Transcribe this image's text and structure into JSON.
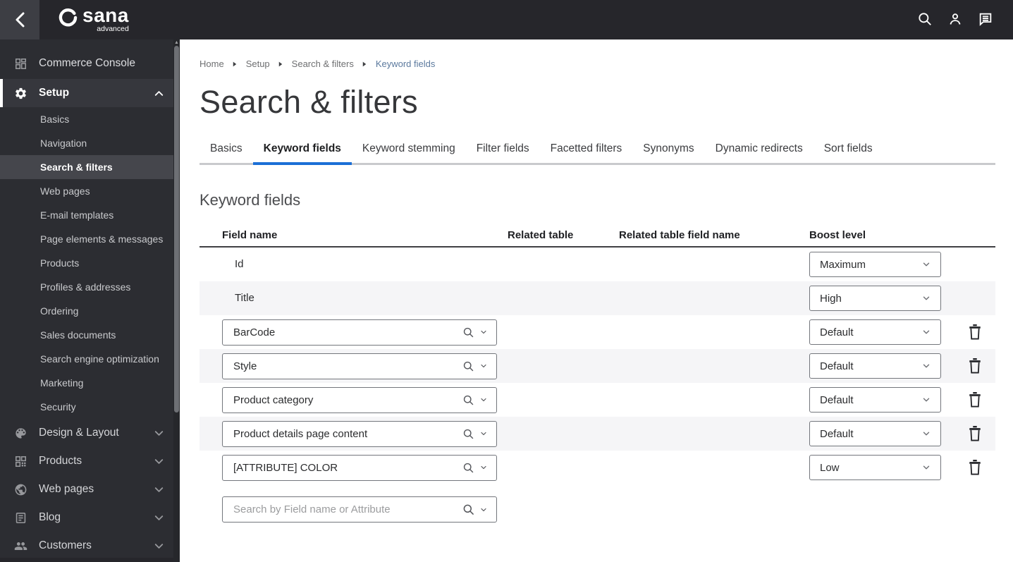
{
  "topbar": {
    "brand": "sana",
    "brand_sub": "advanced",
    "back_icon": "chevron-left-icon",
    "action_icons": [
      "search-icon",
      "account-icon",
      "feedback-icon"
    ]
  },
  "sidebar": {
    "top_item": {
      "label": "Commerce Console",
      "icon": "dashboard-icon"
    },
    "setup": {
      "label": "Setup",
      "icon": "gear-icon",
      "expanded": true
    },
    "setup_children": [
      {
        "label": "Basics",
        "active": false
      },
      {
        "label": "Navigation",
        "active": false
      },
      {
        "label": "Search & filters",
        "active": true
      },
      {
        "label": "Web pages",
        "active": false
      },
      {
        "label": "E-mail templates",
        "active": false
      },
      {
        "label": "Page elements & messages",
        "active": false
      },
      {
        "label": "Products",
        "active": false
      },
      {
        "label": "Profiles & addresses",
        "active": false
      },
      {
        "label": "Ordering",
        "active": false
      },
      {
        "label": "Sales documents",
        "active": false
      },
      {
        "label": "Search engine optimization",
        "active": false
      },
      {
        "label": "Marketing",
        "active": false
      },
      {
        "label": "Security",
        "active": false
      }
    ],
    "groups": [
      {
        "label": "Design & Layout",
        "icon": "palette-icon"
      },
      {
        "label": "Products",
        "icon": "products-grid-icon"
      },
      {
        "label": "Web pages",
        "icon": "globe-icon"
      },
      {
        "label": "Blog",
        "icon": "blog-icon"
      },
      {
        "label": "Customers",
        "icon": "customers-icon"
      }
    ]
  },
  "breadcrumb": [
    "Home",
    "Setup",
    "Search & filters",
    "Keyword fields"
  ],
  "page": {
    "title": "Search & filters",
    "section_heading": "Keyword fields"
  },
  "tabs": [
    {
      "label": "Basics",
      "active": false
    },
    {
      "label": "Keyword fields",
      "active": true
    },
    {
      "label": "Keyword stemming",
      "active": false
    },
    {
      "label": "Filter fields",
      "active": false
    },
    {
      "label": "Facetted filters",
      "active": false
    },
    {
      "label": "Synonyms",
      "active": false
    },
    {
      "label": "Dynamic redirects",
      "active": false
    },
    {
      "label": "Sort fields",
      "active": false
    }
  ],
  "table": {
    "headers": [
      "Field name",
      "Related table",
      "Related table field name",
      "Boost level"
    ],
    "rows": [
      {
        "field": "Id",
        "editable": false,
        "related_table": "",
        "related_field": "",
        "boost": "Maximum",
        "deletable": false
      },
      {
        "field": "Title",
        "editable": false,
        "related_table": "",
        "related_field": "",
        "boost": "High",
        "deletable": false
      },
      {
        "field": "BarCode",
        "editable": true,
        "related_table": "",
        "related_field": "",
        "boost": "Default",
        "deletable": true
      },
      {
        "field": "Style",
        "editable": true,
        "related_table": "",
        "related_field": "",
        "boost": "Default",
        "deletable": true
      },
      {
        "field": "Product category",
        "editable": true,
        "related_table": "",
        "related_field": "",
        "boost": "Default",
        "deletable": true
      },
      {
        "field": "Product details page content",
        "editable": true,
        "related_table": "",
        "related_field": "",
        "boost": "Default",
        "deletable": true
      },
      {
        "field": "[ATTRIBUTE] COLOR",
        "editable": true,
        "related_table": "",
        "related_field": "",
        "boost": "Low",
        "deletable": true
      }
    ],
    "search_placeholder": "Search by Field name or Attribute"
  },
  "colors": {
    "topbar_bg": "#26262b",
    "back_btn_bg": "#3d3e44",
    "sidebar_bg": "#2c2d32",
    "setup_row_bg": "#36373d",
    "active_subitem_bg": "#45464c",
    "accent_blue": "#1b6fd6",
    "breadcrumb_current": "#5c7a9e",
    "row_alt_bg": "#f5f5f7"
  }
}
